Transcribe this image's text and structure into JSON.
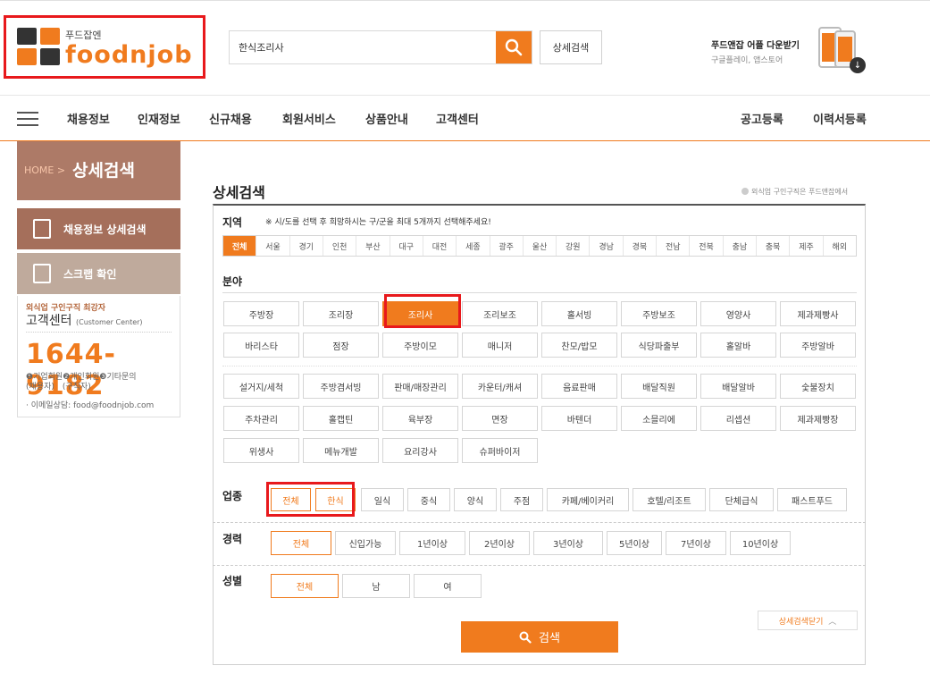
{
  "header": {
    "logo_sub": "푸드잡엔",
    "logo_brand": "foodnjob",
    "search_value": "한식조리사",
    "detail_search_label": "상세검색",
    "app_title": "푸드앤잡 어플 다운받기",
    "app_sub": "구글플레이, 앱스토어",
    "accent_color": "#f07b1e"
  },
  "gnb": {
    "items": [
      "채용정보",
      "인재정보",
      "신규채용",
      "회원서비스",
      "상품안내",
      "고객센터"
    ],
    "right_items": [
      "공고등록",
      "이력서등록"
    ]
  },
  "sidebar": {
    "home": "HOME",
    "title": "상세검색",
    "btn1": "채용정보 상세검색",
    "btn2": "스크랩 확인",
    "cs_line1": "외식업 구인구직 최강자",
    "cs_line2": "고객센터",
    "cs_line2_en": "(Customer Center)",
    "cs_phone": "1644-9182",
    "cs_line3a": "❶기업회원❷개인회원❸기타문의",
    "cs_line3b": "(채용자)　(구직자)",
    "cs_email": "· 이메일상담: food@foodnjob.com"
  },
  "main": {
    "title": "상세검색",
    "note": "외식업 구인구직은 푸드앤잡에서",
    "region_label": "지역",
    "region_note": "※ 시/도를 선택 후 희망하시는 구/군을 최대 5개까지 선택해주세요!",
    "regions": [
      "전체",
      "서울",
      "경기",
      "인천",
      "부산",
      "대구",
      "대전",
      "세종",
      "광주",
      "울산",
      "강원",
      "경남",
      "경북",
      "전남",
      "전북",
      "충남",
      "충북",
      "제주",
      "해외"
    ],
    "field_label": "분야",
    "fields_row1": [
      "주방장",
      "조리장",
      "조리사",
      "조리보조",
      "홀서빙",
      "주방보조",
      "영양사",
      "제과제빵사"
    ],
    "fields_row2": [
      "바리스타",
      "점장",
      "주방이모",
      "매니저",
      "찬모/밥모",
      "식당파출부",
      "홀알바",
      "주방알바"
    ],
    "fields_row3": [
      "설거지/세척",
      "주방겸서빙",
      "판매/매장관리",
      "카운터/캐셔",
      "음료판매",
      "배달직원",
      "배달알바",
      "숯불장치"
    ],
    "fields_row4": [
      "주차관리",
      "홀캡틴",
      "육부장",
      "면장",
      "바텐더",
      "소믈리에",
      "리셉션",
      "제과제빵장"
    ],
    "fields_row5": [
      "위생사",
      "메뉴개발",
      "요리강사",
      "슈퍼바이저"
    ],
    "industry_label": "업종",
    "industries": [
      "전체",
      "한식",
      "일식",
      "중식",
      "양식",
      "주점",
      "카페/베이커리",
      "호텔/리조트",
      "단체급식",
      "패스트푸드"
    ],
    "career_label": "경력",
    "careers": [
      "전체",
      "신입가능",
      "1년이상",
      "2년이상",
      "3년이상",
      "5년이상",
      "7년이상",
      "10년이상"
    ],
    "gender_label": "성별",
    "genders": [
      "전체",
      "남",
      "여"
    ],
    "collapse_label": "상세검색닫기",
    "search_label": "검색"
  }
}
